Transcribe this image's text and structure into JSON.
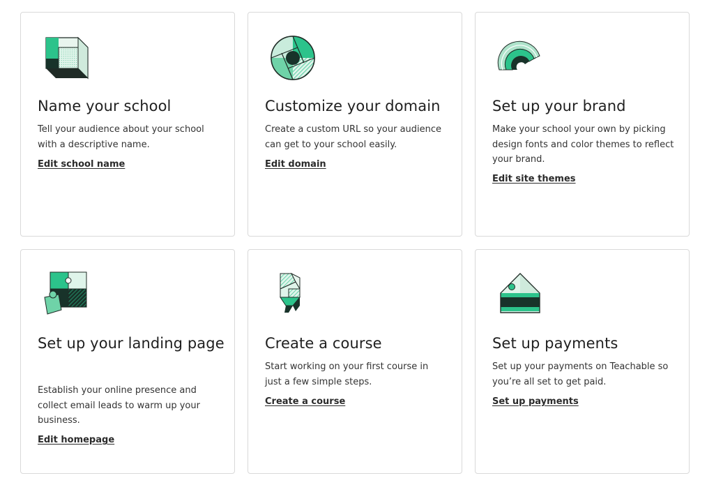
{
  "cards": [
    {
      "title": "Name your school",
      "description": "Tell your audience about your school with a descriptive name.",
      "link": "Edit school name",
      "icon": "cube-icon"
    },
    {
      "title": "Customize your domain",
      "description": "Create a custom URL so your audience can get to your school easily.",
      "link": "Edit domain",
      "icon": "aperture-icon"
    },
    {
      "title": "Set up your brand",
      "description": "Make your school your own by picking design fonts and color themes to reflect your brand.",
      "link": "Edit site themes",
      "icon": "rainbow-icon"
    },
    {
      "title": "Set up your landing page",
      "description": "Establish your online presence and collect email leads to warm up your business.",
      "link": "Edit homepage",
      "icon": "puzzle-icon"
    },
    {
      "title": "Create a course",
      "description": "Start working on your first course in just a few simple steps.",
      "link": "Create a course",
      "icon": "blocks-icon"
    },
    {
      "title": "Set up payments",
      "description": "Set up your payments on Teachable so you’re all set to get paid.",
      "link": "Set up payments",
      "icon": "price-tag-icon"
    }
  ],
  "colors": {
    "green": "#2cc38b",
    "light_green": "#aee3cb",
    "pale_green": "#dff4ea",
    "dark_green": "#18332a",
    "border": "#d9d9d9"
  }
}
